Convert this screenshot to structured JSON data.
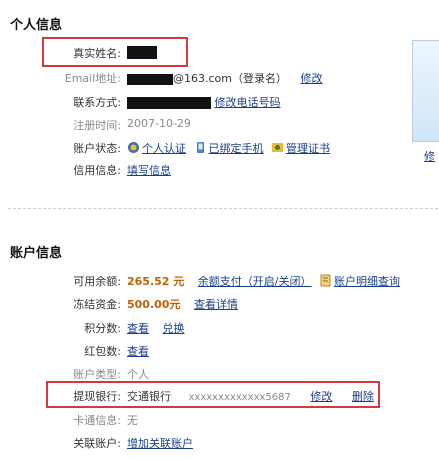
{
  "personal": {
    "title": "个人信息",
    "name_label": "真实姓名:",
    "email_label": "Email地址:",
    "email_value": "@163.com",
    "email_note": "（登录名）",
    "email_edit": "修改",
    "contact_label": "联系方式:",
    "contact_edit": "修改电话号码",
    "register_label": "注册时间:",
    "register_value": "2007-10-29",
    "status_label": "账户状态:",
    "status_items": [
      "个人认证",
      "已绑定手机",
      "管理证书"
    ],
    "credit_label": "信用信息:",
    "credit_link": "填写信息",
    "side_link": "修"
  },
  "account": {
    "title": "账户信息",
    "balance_label": "可用余额:",
    "balance_value": "265.52 元",
    "balance_pay": "余额支付（开启/关闭）",
    "balance_detail": "账户明细查询",
    "frozen_label": "冻结资金:",
    "frozen_value": "500.00元",
    "frozen_link": "查看详情",
    "points_label": "积分数:",
    "points_view": "查看",
    "points_redeem": "兑换",
    "redpack_label": "红包数:",
    "redpack_view": "查看",
    "type_label": "账户类型:",
    "type_value": "个人",
    "bank_label": "提现银行:",
    "bank_name": "交通银行",
    "bank_number": "xxxxxxxxxxxxx5687",
    "bank_edit": "修改",
    "bank_delete": "删除",
    "card_label": "卡通信息:",
    "card_value": "无",
    "linked_label": "关联账户:",
    "linked_link": "增加关联账户"
  },
  "colors": {
    "link": "#1a3e8c",
    "money": "#c06000",
    "highlight": "#d23a3a"
  }
}
